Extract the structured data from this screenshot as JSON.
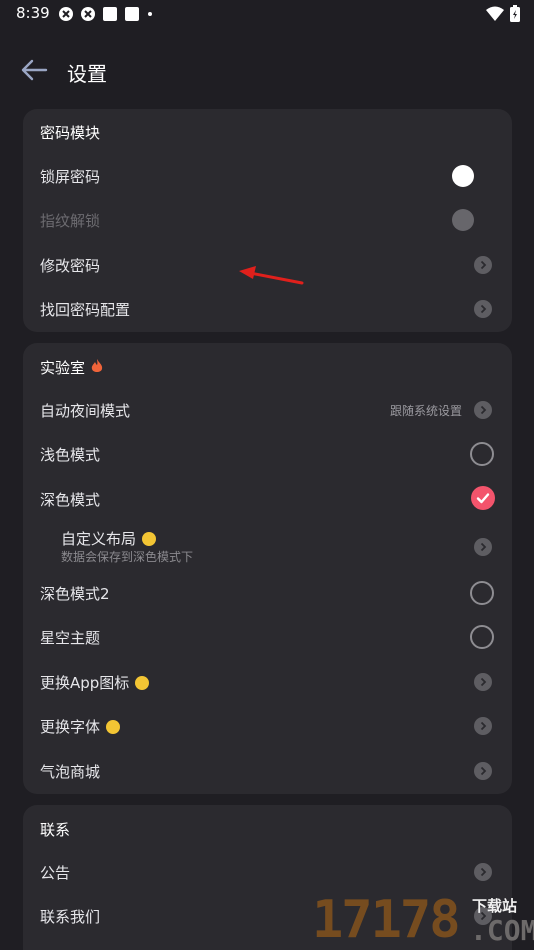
{
  "status": {
    "time": "8:39"
  },
  "header": {
    "title": "设置"
  },
  "password": {
    "title": "密码模块",
    "items": [
      {
        "label": "锁屏密码"
      },
      {
        "label": "指纹解锁"
      },
      {
        "label": "修改密码"
      },
      {
        "label": "找回密码配置"
      }
    ]
  },
  "lab": {
    "title": "实验室",
    "items": [
      {
        "label": "自动夜间模式",
        "value": "跟随系统设置"
      },
      {
        "label": "浅色模式"
      },
      {
        "label": "深色模式"
      },
      {
        "label": "自定义布局",
        "sub": "数据会保存到深色模式下"
      },
      {
        "label": "深色模式2"
      },
      {
        "label": "星空主题"
      },
      {
        "label": "更换App图标"
      },
      {
        "label": "更换字体"
      },
      {
        "label": "气泡商城"
      }
    ]
  },
  "contact": {
    "title": "联系",
    "items": [
      {
        "label": "公告"
      },
      {
        "label": "联系我们"
      }
    ]
  },
  "watermark": {
    "number": "17178",
    "site": "下载站",
    "domain": ".COM"
  },
  "colors": {
    "accent": "#f3546c",
    "vip": "#f3c534",
    "flame": "#f0643a",
    "arrow": "#e0201c"
  }
}
